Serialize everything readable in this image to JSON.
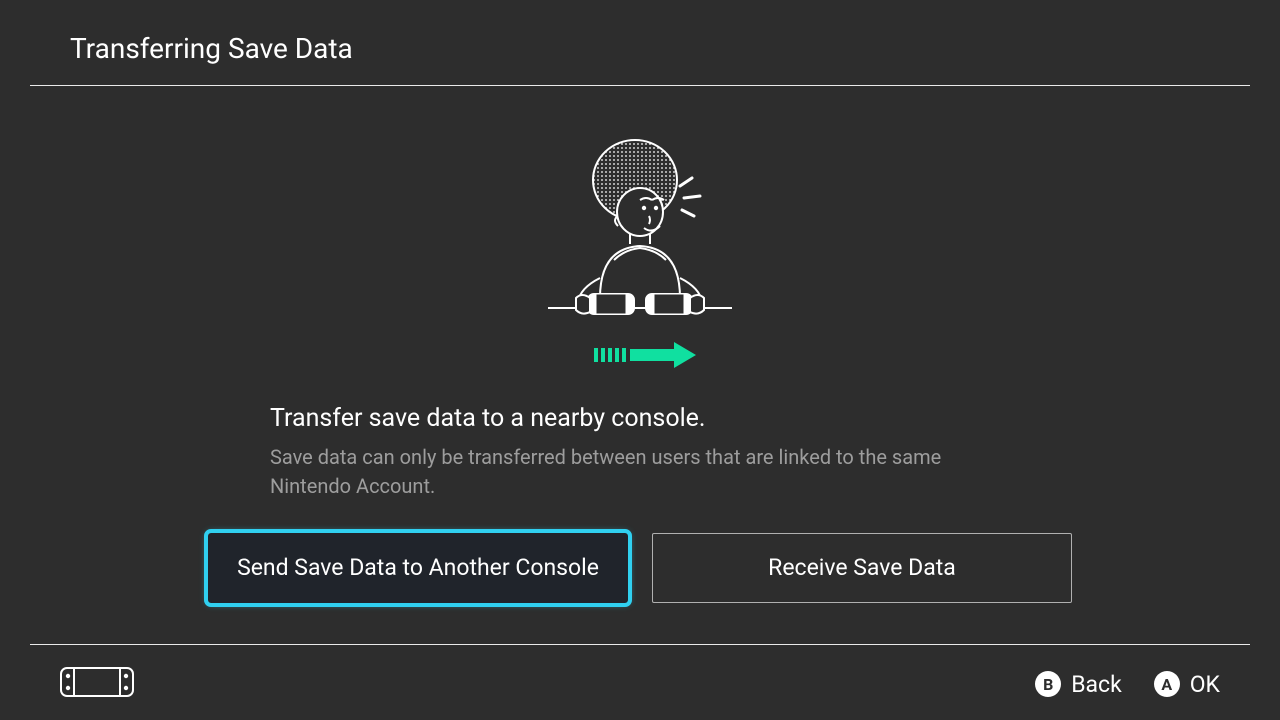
{
  "header": {
    "title": "Transferring Save Data"
  },
  "main": {
    "heading": "Transfer save data to a nearby console.",
    "description": "Save data can only be transferred between users that are linked to the same Nintendo Account."
  },
  "buttons": {
    "send": "Send Save Data to Another Console",
    "receive": "Receive Save Data"
  },
  "footer": {
    "back_glyph": "B",
    "back_label": "Back",
    "ok_glyph": "A",
    "ok_label": "OK"
  },
  "colors": {
    "accent": "#10e0a0",
    "highlight": "#30d0f0"
  }
}
